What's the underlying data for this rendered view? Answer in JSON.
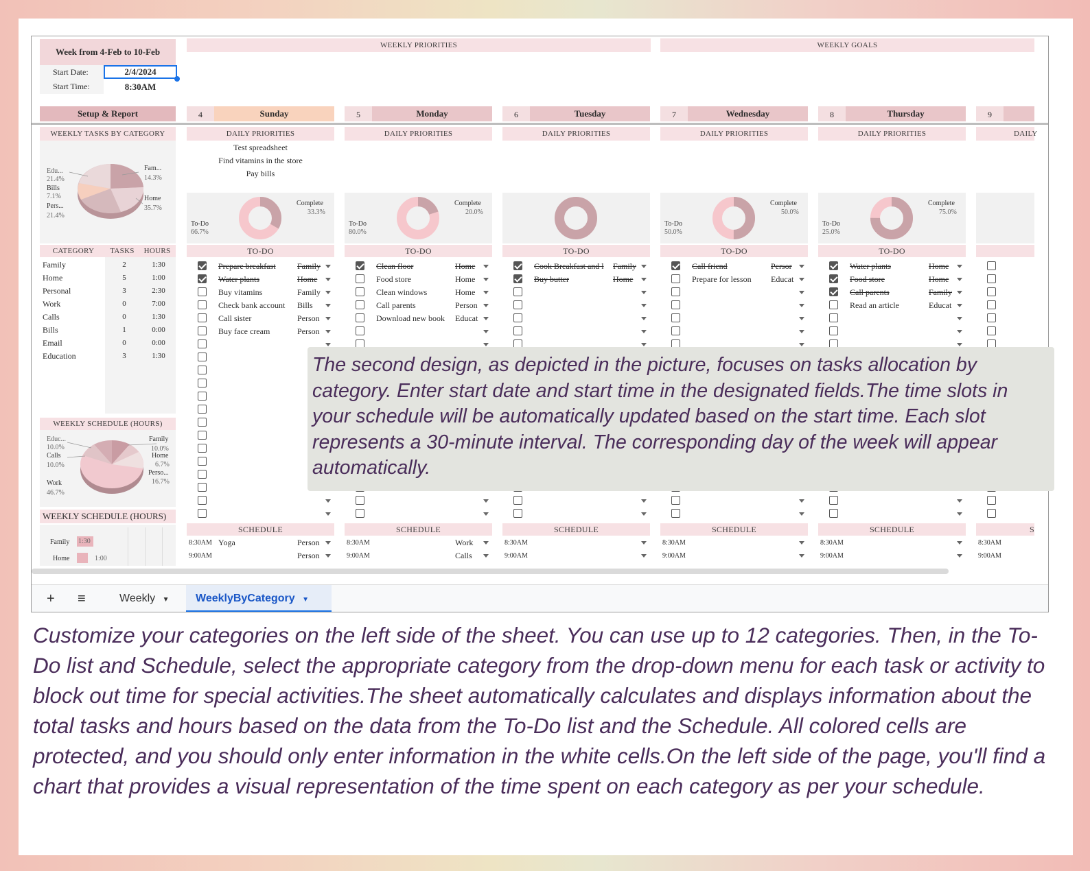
{
  "week_title": "Week from 4-Feb to 10-Feb",
  "start_date_label": "Start Date:",
  "start_date": "2/4/2024",
  "start_time_label": "Start Time:",
  "start_time": "8:30AM",
  "weekly_priorities": "WEEKLY PRIORITIES",
  "weekly_goals": "WEEKLY GOALS",
  "setup_report": "Setup & Report",
  "weekly_tasks_by_category": "WEEKLY TASKS BY CATEGORY",
  "weekly_schedule_hours": "WEEKLY SCHEDULE (HOURS)",
  "weekly_schedule_hours2": "WEEKLY SCHEDULE (HOURS)",
  "days": [
    {
      "num": "4",
      "name": "Sunday"
    },
    {
      "num": "5",
      "name": "Monday"
    },
    {
      "num": "6",
      "name": "Tuesday"
    },
    {
      "num": "7",
      "name": "Wednesday"
    },
    {
      "num": "8",
      "name": "Thursday"
    },
    {
      "num": "9",
      "name": ""
    }
  ],
  "daily_priorities": "DAILY PRIORITIES",
  "daily_priorities_cut": "DAILY",
  "todo": "TO-DO",
  "schedule": "SCHEDULE",
  "schedule_cut": "S",
  "sunday_priorities": [
    "Test spreadsheet",
    "Find vitamins in the store",
    "Pay bills"
  ],
  "category_table": {
    "headers": [
      "CATEGORY",
      "TASKS",
      "HOURS"
    ],
    "rows": [
      [
        "Family",
        "2",
        "1:30"
      ],
      [
        "Home",
        "5",
        "1:00"
      ],
      [
        "Personal",
        "3",
        "2:30"
      ],
      [
        "Work",
        "0",
        "7:00"
      ],
      [
        "Calls",
        "0",
        "1:30"
      ],
      [
        "Bills",
        "1",
        "0:00"
      ],
      [
        "Email",
        "0",
        "0:00"
      ],
      [
        "Education",
        "3",
        "1:30"
      ]
    ]
  },
  "pie_tasks_labels": {
    "edu": "Edu...",
    "edu_pct": "21.4%",
    "bills": "Bills",
    "bills_pct": "7.1%",
    "pers": "Pers...",
    "pers_pct": "21.4%",
    "fam": "Fam...",
    "fam_pct": "14.3%",
    "home": "Home",
    "home_pct": "35.7%"
  },
  "pie_sched_labels": {
    "educ": "Educ...",
    "educ_pct": "10.0%",
    "calls": "Calls",
    "calls_pct": "10.0%",
    "work": "Work",
    "work_pct": "46.7%",
    "family": "Family",
    "family_pct": "10.0%",
    "home": "Home",
    "home_pct": "6.7%",
    "perso": "Perso...",
    "perso_pct": "16.7%"
  },
  "bar_sched": {
    "family": "Family",
    "family_val": "1:30",
    "home": "Home",
    "home_val": "1:00"
  },
  "donuts": [
    {
      "todo": "To-Do",
      "todo_pct": "66.7%",
      "complete": "Complete",
      "complete_pct": "33.3%"
    },
    {
      "todo": "To-Do",
      "todo_pct": "80.0%",
      "complete": "Complete",
      "complete_pct": "20.0%"
    },
    {},
    {
      "todo": "To-Do",
      "todo_pct": "50.0%",
      "complete": "Complete",
      "complete_pct": "50.0%"
    },
    {
      "todo": "To-Do",
      "todo_pct": "25.0%",
      "complete": "Complete",
      "complete_pct": "75.0%"
    }
  ],
  "todos": [
    [
      [
        "Prepare breakfast",
        "Family",
        true
      ],
      [
        "Water plants",
        "Home",
        true
      ],
      [
        "Buy vitamins",
        "Family",
        false
      ],
      [
        "Check bank account",
        "Bills",
        false
      ],
      [
        "Call sister",
        "Person",
        false
      ],
      [
        "Buy face cream",
        "Person",
        false
      ]
    ],
    [
      [
        "Clean floor",
        "Home",
        true
      ],
      [
        "Food store",
        "Home",
        false
      ],
      [
        "Clean windows",
        "Home",
        false
      ],
      [
        "Call parents",
        "Person",
        false
      ],
      [
        "Download new book",
        "Educat",
        false
      ]
    ],
    [
      [
        "Cook Breakfast and l",
        "Family",
        true
      ],
      [
        "Buy butter",
        "Home",
        true
      ]
    ],
    [
      [
        "Call friend",
        "Persor",
        true
      ],
      [
        "Prepare for lesson",
        "Educat",
        false
      ]
    ],
    [
      [
        "Water plants",
        "Home",
        true
      ],
      [
        "Food store",
        "Home",
        true
      ],
      [
        "Call parents",
        "Family",
        true
      ],
      [
        "Read an article",
        "Educat",
        false
      ]
    ]
  ],
  "schedule_rows": [
    [
      [
        "8:30AM",
        "Yoga",
        "Person"
      ],
      [
        "9:00AM",
        "",
        "Person"
      ]
    ],
    [
      [
        "8:30AM",
        "",
        "Work"
      ],
      [
        "9:00AM",
        "",
        "Calls"
      ]
    ],
    [
      [
        "8:30AM",
        "",
        ""
      ],
      [
        "9:00AM",
        "",
        ""
      ]
    ],
    [
      [
        "8:30AM",
        "",
        ""
      ],
      [
        "9:00AM",
        "",
        ""
      ]
    ],
    [
      [
        "8:30AM",
        "",
        ""
      ],
      [
        "9:00AM",
        "",
        ""
      ]
    ],
    [
      [
        "8:30AM",
        "",
        ""
      ],
      [
        "9:00AM",
        "",
        ""
      ]
    ]
  ],
  "tabs": {
    "add": "+",
    "menu": "≡",
    "weekly": "Weekly",
    "weekly_by_category": "WeeklyByCategory"
  },
  "overlay_text": "The second design, as depicted in the picture, focuses on tasks allocation by category. Enter start date and start time in the designated fields.The time slots in your schedule will be automatically updated based on the start time. Each slot represents a 30-minute interval. The corresponding day of the week will appear automatically.",
  "bottom_text": "Customize your categories on the left side of the sheet. You can use up to 12 categories. Then, in the To-Do list and Schedule, select the appropriate category from the drop-down menu for each task or activity to block out time for special activities.The sheet automatically calculates and displays information about the total tasks and hours based on the data from the To-Do list and the Schedule. All colored cells are protected, and you should only enter information in the white cells.On the left side of the page, you'll find a chart that provides a visual representation of the time spent on each category as per your schedule.",
  "colors": {
    "pink_header": "#e9c6c9",
    "light_pink": "#f7e1e4",
    "sunday": "#f9d3bd",
    "accent_blue": "#1a73e8",
    "text_purple": "#4a2d5a"
  }
}
